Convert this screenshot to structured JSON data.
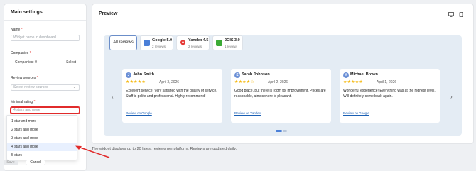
{
  "settings": {
    "title": "Main settings",
    "name_label": "Name",
    "name_placeholder": "Widget name in dashboard",
    "companies_label": "Companies",
    "companies_value": "Companies: 0",
    "companies_select": "Select",
    "review_sources_label": "Review sources",
    "review_sources_placeholder": "Select review sources",
    "minimal_rating_label": "Minimal rating",
    "minimal_rating_placeholder": "4 stars and more",
    "rating_options": [
      "1 star and more",
      "2 stars and more",
      "3 stars and more",
      "4 stars and more",
      "5 stars"
    ],
    "selected_rating_index": 3,
    "save_label": "Save",
    "cancel_label": "Cancel",
    "required_mark": "*"
  },
  "preview": {
    "title": "Preview",
    "desktop_icon": "monitor-icon",
    "mobile_icon": "phone-icon",
    "tabs": [
      {
        "label": "All reviews"
      },
      {
        "name": "Google 5.0",
        "count": "2 reviews",
        "icon": "google-business-icon",
        "color": "#4a7fd8"
      },
      {
        "name": "Yandex 4.5",
        "count": "2 reviews",
        "icon": "map-pin-icon",
        "color": "#e53935"
      },
      {
        "name": "2GIS 3.0",
        "count": "1 review",
        "icon": "2gis-icon",
        "color": "#3aaa35"
      }
    ],
    "reviews": [
      {
        "initial": "J",
        "author": "John Smith",
        "stars": "★★★★★",
        "date": "April 3, 2026",
        "text": "Excellent service! Very satisfied with the quality of service. Staff is polite and professional. Highly recommend!",
        "source": "Review on Google"
      },
      {
        "initial": "S",
        "author": "Sarah Johnson",
        "stars": "★★★★☆",
        "date": "April 2, 2026",
        "text": "Good place, but there is room for improvement. Prices are reasonable, atmosphere is pleasant.",
        "source": "Review on Yandex"
      },
      {
        "initial": "M",
        "author": "Michael Brown",
        "stars": "★★★★★",
        "date": "April 1, 2026",
        "text": "Wonderful experience! Everything was at the highest level. Will definitely come back again.",
        "source": "Review on Google"
      }
    ],
    "prev_arrow": "‹",
    "next_arrow": "›",
    "footnote": "The widget displays up to 20 latest reviews per platform. Reviews are updated daily."
  },
  "colors": {
    "accent": "#e12b2b",
    "link": "#1a5fb4",
    "star": "#f4b400"
  }
}
